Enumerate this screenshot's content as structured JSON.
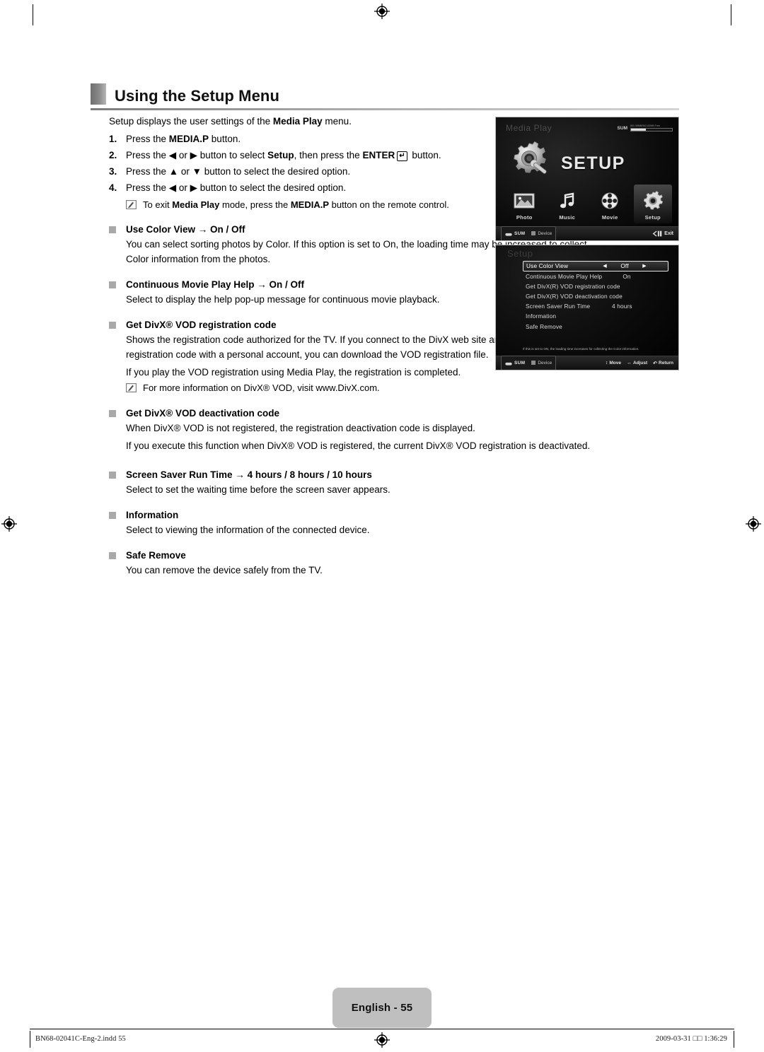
{
  "heading": {
    "title": "Using the Setup Menu"
  },
  "intro": {
    "text_parts": [
      "Setup displays the user settings of the ",
      "Media Play",
      " menu."
    ],
    "plain": "Setup displays the user settings of the Media Play menu."
  },
  "steps": [
    {
      "num": "1.",
      "text": "Press the MEDIA.P button."
    },
    {
      "num": "2.",
      "text": "Press the ◀ or ▶ button to select Setup, then press the ENTER button."
    },
    {
      "num": "3.",
      "text": "Press the ▲ or ▼ button to select the desired option."
    },
    {
      "num": "4.",
      "text": "Press the ◀ or ▶ button to select the desired option."
    }
  ],
  "step_note": "To exit Media Play mode, press the MEDIA.P button on the remote control.",
  "bullets": [
    {
      "title": "Use Color View → On / Off",
      "lines": [
        "You can select sorting photos by Color. If this option is set to On, the loading time may be increased to collect Color information from the photos."
      ],
      "notes": []
    },
    {
      "title": "Continuous Movie Play Help → On / Off",
      "lines": [
        "Select to display the help pop-up message for continuous movie playback."
      ],
      "notes": []
    },
    {
      "title": "Get DivX® VOD registration code",
      "lines": [
        "Shows the registration code authorized for the TV. If you connect to the DivX web site and register the registration code with a personal account, you can download the VOD registration file.",
        "If you play the VOD registration using Media Play, the registration is completed."
      ],
      "notes": [
        "For more information on DivX® VOD, visit www.DivX.com."
      ]
    },
    {
      "title": "Get DivX® VOD deactivation code",
      "lines": [
        "When DivX® VOD is not registered, the registration deactivation code is displayed.",
        "If you execute this function when DivX® VOD is registered, the current DivX® VOD registration is deactivated."
      ],
      "notes": []
    },
    {
      "title": "Screen Saver Run Time → 4 hours / 8 hours / 10 hours",
      "lines": [
        "Select to set the waiting time before the screen saver appears."
      ],
      "notes": []
    },
    {
      "title": "Information",
      "lines": [
        "Select to viewing the information of the connected device."
      ],
      "notes": []
    },
    {
      "title": "Safe Remove",
      "lines": [
        "You can remove the device safely from the TV."
      ],
      "notes": []
    }
  ],
  "screenshot_media_play": {
    "title": "Media Play",
    "sum_label": "SUM",
    "capacity_text": "851.06MB/962.62MB Free",
    "hero_word": "SETUP",
    "icons": [
      {
        "label": "Photo",
        "icon": "photo-icon",
        "selected": false
      },
      {
        "label": "Music",
        "icon": "music-note-icon",
        "selected": false
      },
      {
        "label": "Movie",
        "icon": "film-reel-icon",
        "selected": false
      },
      {
        "label": "Setup",
        "icon": "gear-icon",
        "selected": true
      }
    ],
    "footer": {
      "source": "SUM",
      "device": "Device",
      "exit": "Exit"
    }
  },
  "screenshot_setup": {
    "title": "Setup",
    "rows": [
      {
        "label": "Use Color View",
        "value": "Off",
        "selected": true,
        "arrows": true
      },
      {
        "label": "Continuous Movie Play Help",
        "value": "On",
        "selected": false,
        "arrows": false
      },
      {
        "label": "Get DivX(R) VOD registration code",
        "value": "",
        "selected": false,
        "arrows": false
      },
      {
        "label": "Get DivX(R) VOD deactivation code",
        "value": "",
        "selected": false,
        "arrows": false
      },
      {
        "label": "Screen Saver Run Time",
        "value": "4 hours",
        "selected": false,
        "arrows": false
      },
      {
        "label": "Information",
        "value": "",
        "selected": false,
        "arrows": false
      },
      {
        "label": "Safe Remove",
        "value": "",
        "selected": false,
        "arrows": false
      }
    ],
    "help_text": "If this is set to ON, the loading time increases for collecting the Color information.",
    "footer": {
      "source": "SUM",
      "device": "Device",
      "move": "Move",
      "adjust": "Adjust",
      "return": "Return"
    }
  },
  "page_footer": {
    "language_page": "English - 55",
    "file_name": "BN68-02041C-Eng-2.indd   55",
    "timestamp": "2009-03-31   □□ 1:36:29"
  },
  "colors": {
    "heading_tab": "#8a8a8a",
    "bullet_square": "#a9a9a9",
    "badge": "#bfbfbf",
    "tv_background": "#000000"
  }
}
